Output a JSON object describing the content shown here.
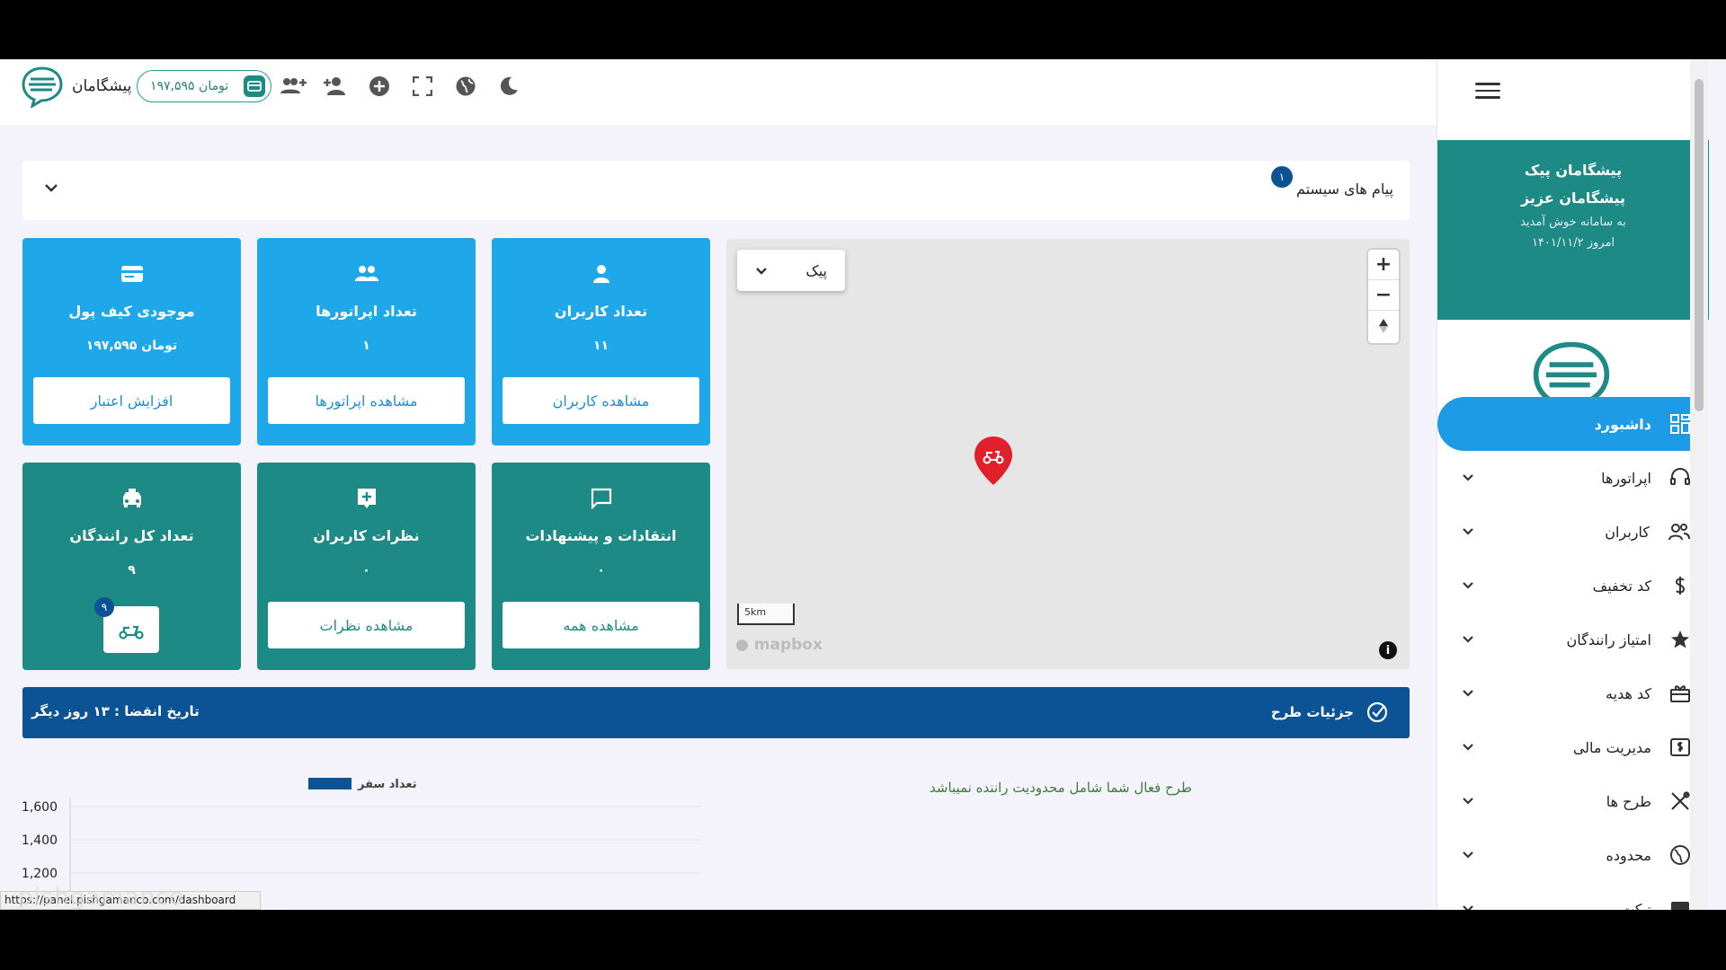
{
  "header": {
    "brand": "پیشگامان",
    "wallet_amount": "۱۹۷,۵۹۵ تومان"
  },
  "sidebar": {
    "company": "پیشگامان پیک",
    "user": "پیشگامان عزیز",
    "welcome": "به سامانه خوش آمدید",
    "today": "امروز ۱۴۰۱/۱۱/۲",
    "active_item": "داشبورد",
    "items": [
      {
        "label": "اپراتورها",
        "icon": "headset-icon"
      },
      {
        "label": "کاربران",
        "icon": "users-icon"
      },
      {
        "label": "کد تخفیف",
        "icon": "dollar-icon"
      },
      {
        "label": "امتیاز رانندگان",
        "icon": "star-icon"
      },
      {
        "label": "کد هدیه",
        "icon": "gift-icon"
      },
      {
        "label": "مدیریت مالی",
        "icon": "finance-icon"
      },
      {
        "label": "طرح ها",
        "icon": "tools-icon"
      },
      {
        "label": "محدوده",
        "icon": "globe-icon"
      },
      {
        "label": "تیکت",
        "icon": "ticket-icon"
      }
    ]
  },
  "system_messages": {
    "title": "پیام های سیستم",
    "count": "۱"
  },
  "cards": {
    "wallet": {
      "title": "موجودی کیف پول",
      "value": "۱۹۷,۵۹۵ تومان",
      "button": "افزایش اعتبار"
    },
    "operators": {
      "title": "تعداد اپراتورها",
      "value": "۱",
      "button": "مشاهده اپراتورها"
    },
    "users": {
      "title": "تعداد کاربران",
      "value": "۱۱",
      "button": "مشاهده کاربران"
    },
    "drivers": {
      "title": "تعداد کل رانندگان",
      "value": "۹",
      "badge": "۹"
    },
    "reviews": {
      "title": "نظرات کاربران",
      "value": "۰",
      "button": "مشاهده نظرات"
    },
    "feedback": {
      "title": "انتقادات و پیشنهادات",
      "value": "۰",
      "button": "مشاهده همه"
    }
  },
  "map": {
    "vehicle_select": "پیک",
    "scale_label": "5km",
    "attribution": "mapbox",
    "zoom_in": "+",
    "zoom_out": "−"
  },
  "plan": {
    "details_label": "جزئیات طرح",
    "expiry": "تاریخ انقضا : ۱۳ روز دیگر",
    "note": "طرح فعال شما شامل محدودیت راننده نمیباشد"
  },
  "chart_data": {
    "type": "bar",
    "series": [
      {
        "name": "تعداد سفر",
        "values": []
      }
    ],
    "yticks": [
      "1,600",
      "1,400",
      "1,200"
    ],
    "ylim": [
      1200,
      1600
    ],
    "legend": "top",
    "color": "#0b5394"
  },
  "status_url": "https://panel.pishgamanco.com/dashboard",
  "watermark": "pishgamanco"
}
